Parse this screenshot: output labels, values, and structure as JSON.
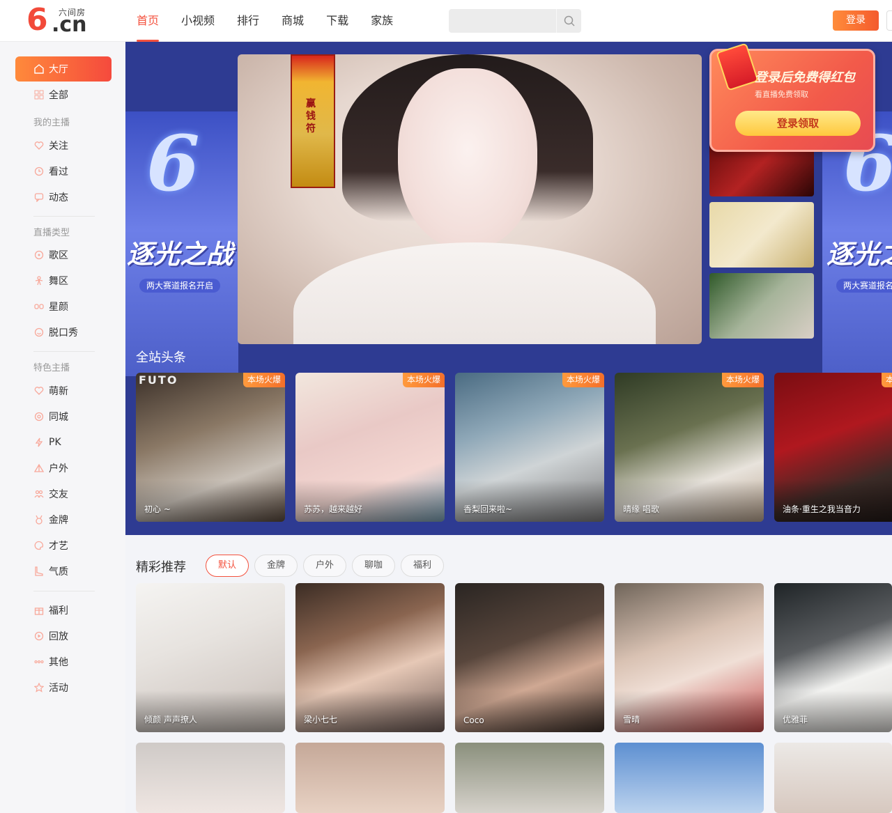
{
  "logo": {
    "sub": "六间房",
    "domain": ".cn",
    "mark": "6"
  },
  "nav": [
    "首页",
    "小视频",
    "排行",
    "商城",
    "下载",
    "家族"
  ],
  "search": {
    "placeholder": ""
  },
  "header": {
    "login": "登录"
  },
  "sidebar": {
    "hall": "大厅",
    "all": "全部",
    "my_section": "我的主播",
    "my": [
      "关注",
      "看过",
      "动态"
    ],
    "type_section": "直播类型",
    "types": [
      "歌区",
      "舞区",
      "星颜",
      "脱口秀"
    ],
    "feature_section": "特色主播",
    "features": [
      "萌新",
      "同城",
      "PK",
      "户外",
      "交友",
      "金牌",
      "才艺",
      "气质"
    ],
    "others": [
      "福利",
      "回放",
      "其他",
      "活动"
    ]
  },
  "hero": {
    "promo_title": "逐光之战",
    "promo_sub": "两大赛道报名开启",
    "talisman": "赢钱符",
    "redpack_title": "登录后免费得红包",
    "redpack_sub": "看直播免费领取",
    "redpack_btn": "登录领取",
    "heading": "全站头条"
  },
  "hot": {
    "badge": "本场火爆",
    "cards": [
      {
        "name": "初心 ~",
        "banner": "FUTO"
      },
      {
        "name": "苏苏，越来越好"
      },
      {
        "name": "香梨回来啦~"
      },
      {
        "name": "晴缘 唱歌"
      },
      {
        "name": "油条·重生之我当音力"
      }
    ]
  },
  "recommend": {
    "title": "精彩推荐",
    "tags": [
      "默认",
      "金牌",
      "户外",
      "聊咖",
      "福利"
    ],
    "cards": [
      {
        "name": "倾颜 声声撩人"
      },
      {
        "name": "梁小七七"
      },
      {
        "name": "Coco"
      },
      {
        "name": "雪晴"
      },
      {
        "name": "优雅菲"
      }
    ]
  },
  "colors": {
    "accent": "#f4513d",
    "hero_bg": "#2e3b92",
    "sidebar_active": "#f54a3d"
  }
}
